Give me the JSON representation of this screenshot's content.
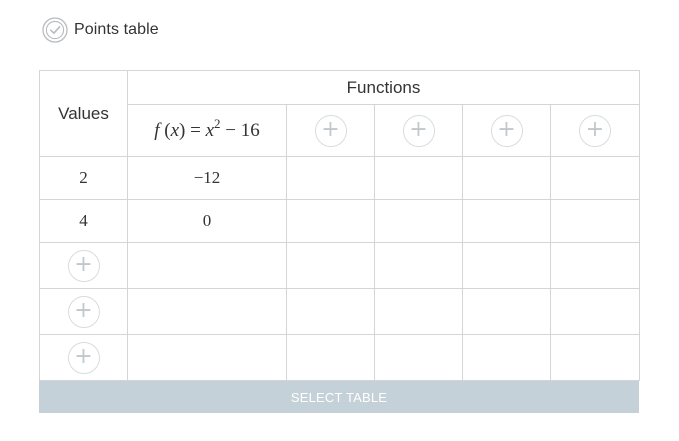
{
  "header": {
    "icon": "check-circle-icon",
    "title": "Points table"
  },
  "table": {
    "values_header": "Values",
    "functions_header": "Functions",
    "function_1": {
      "name": "f",
      "open_paren": "(",
      "var": "x",
      "close_paren": ")",
      "equals": "=",
      "base": "x",
      "exponent": "2",
      "rest": "− 16"
    },
    "add_function_icon": "+",
    "add_value_icon": "+",
    "rows": [
      {
        "x": "2",
        "fx": "−12"
      },
      {
        "x": "4",
        "fx": "0"
      }
    ]
  },
  "select_button": "SELECT TABLE",
  "colors": {
    "border": "#d3d6d8",
    "select_bar": "#c5d1d8",
    "icon_gray": "#c2c7cb",
    "text": "#333333"
  }
}
